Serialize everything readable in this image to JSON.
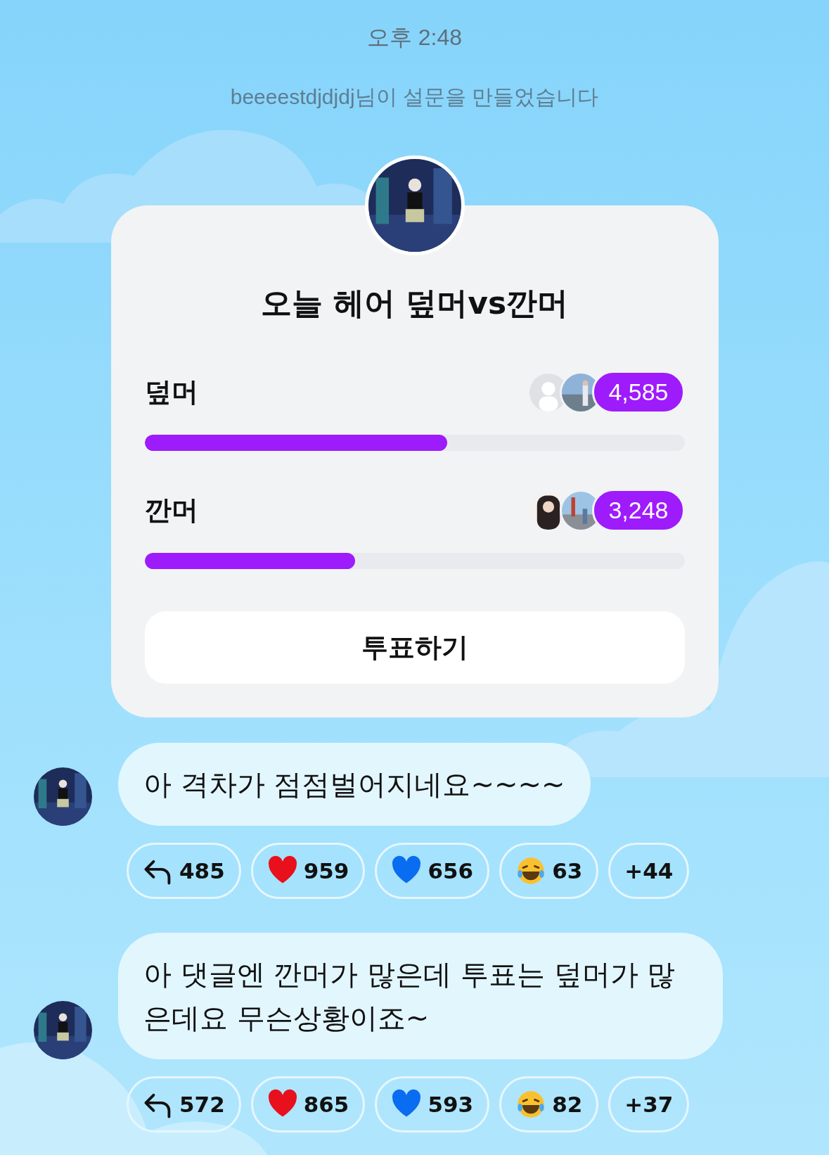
{
  "time": "오후 2:48",
  "notice": "beeeestdjdjdj님이 설문을 만들었습니다",
  "poll": {
    "title": "오늘 헤어 덮머vs깐머",
    "options": [
      {
        "label": "덮머",
        "count": "4,585",
        "level": 0.56
      },
      {
        "label": "깐머",
        "count": "3,248",
        "level": 0.39
      }
    ],
    "vote_button": "투표하기"
  },
  "messages": [
    {
      "text": "아 격차가 점점벌어지네요~~~~",
      "reactions": [
        {
          "kind": "reply",
          "count": "485"
        },
        {
          "kind": "red_heart",
          "count": "959"
        },
        {
          "kind": "blue_heart",
          "count": "656"
        },
        {
          "kind": "laugh",
          "count": "63"
        },
        {
          "kind": "more",
          "count": "+44"
        }
      ]
    },
    {
      "text": "아 댓글엔 깐머가 많은데 투표는 덮머가 많은데요 무슨상황이죠~",
      "reactions": [
        {
          "kind": "reply",
          "count": "572"
        },
        {
          "kind": "red_heart",
          "count": "865"
        },
        {
          "kind": "blue_heart",
          "count": "593"
        },
        {
          "kind": "laugh",
          "count": "82"
        },
        {
          "kind": "more",
          "count": "+37"
        }
      ]
    }
  ]
}
